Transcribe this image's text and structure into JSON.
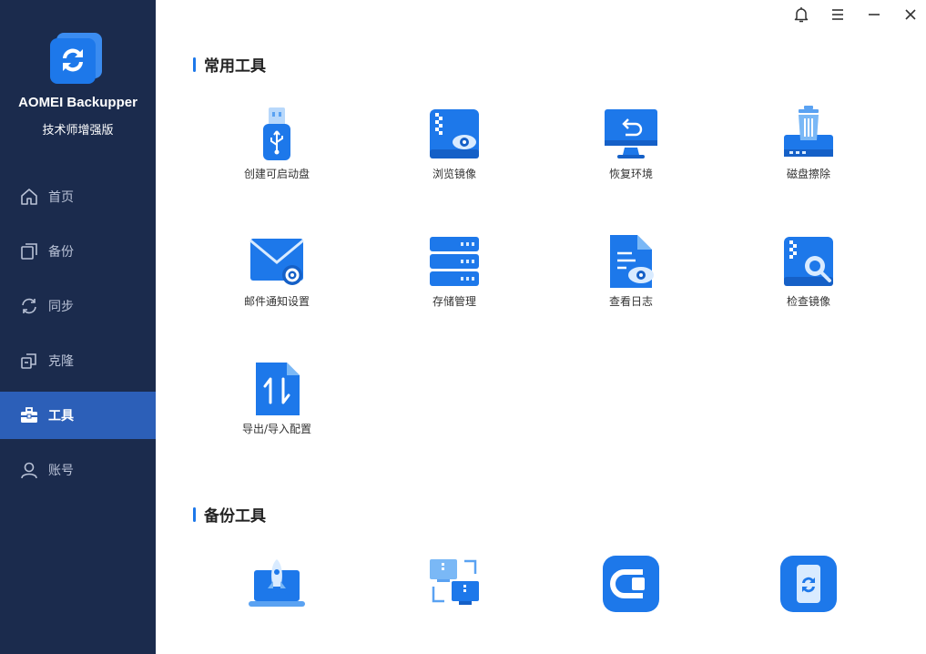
{
  "app": {
    "name": "AOMEI Backupper",
    "edition": "技术师增强版"
  },
  "sidebar": {
    "items": [
      {
        "label": "首页",
        "icon": "home-icon"
      },
      {
        "label": "备份",
        "icon": "backup-icon"
      },
      {
        "label": "同步",
        "icon": "sync-icon"
      },
      {
        "label": "克隆",
        "icon": "clone-icon"
      },
      {
        "label": "工具",
        "icon": "toolbox-icon",
        "active": true
      },
      {
        "label": "账号",
        "icon": "user-icon"
      }
    ]
  },
  "titlebar": {
    "buttons": [
      "bell-icon",
      "menu-icon",
      "minimize-icon",
      "close-icon"
    ]
  },
  "sections": {
    "common": {
      "title": "常用工具",
      "tools": [
        {
          "label": "创建可启动盘",
          "icon": "usb-drive-icon"
        },
        {
          "label": "浏览镜像",
          "icon": "explore-image-icon"
        },
        {
          "label": "恢复环境",
          "icon": "recovery-env-icon"
        },
        {
          "label": "磁盘擦除",
          "icon": "disk-wipe-icon"
        },
        {
          "label": "邮件通知设置",
          "icon": "email-settings-icon"
        },
        {
          "label": "存储管理",
          "icon": "storage-manage-icon"
        },
        {
          "label": "查看日志",
          "icon": "view-log-icon"
        },
        {
          "label": "检查镜像",
          "icon": "check-image-icon"
        },
        {
          "label": "导出/导入配置",
          "icon": "export-import-icon"
        }
      ]
    },
    "backup": {
      "title": "备份工具",
      "tools": [
        {
          "label": "",
          "icon": "rocket-laptop-icon"
        },
        {
          "label": "",
          "icon": "image-deploy-icon"
        },
        {
          "label": "",
          "icon": "centralized-backup-icon"
        },
        {
          "label": "",
          "icon": "phone-sync-icon"
        }
      ]
    }
  },
  "colors": {
    "sidebar_bg": "#1b2b4d",
    "active_nav": "#2c5fb8",
    "accent": "#1d78ea"
  }
}
